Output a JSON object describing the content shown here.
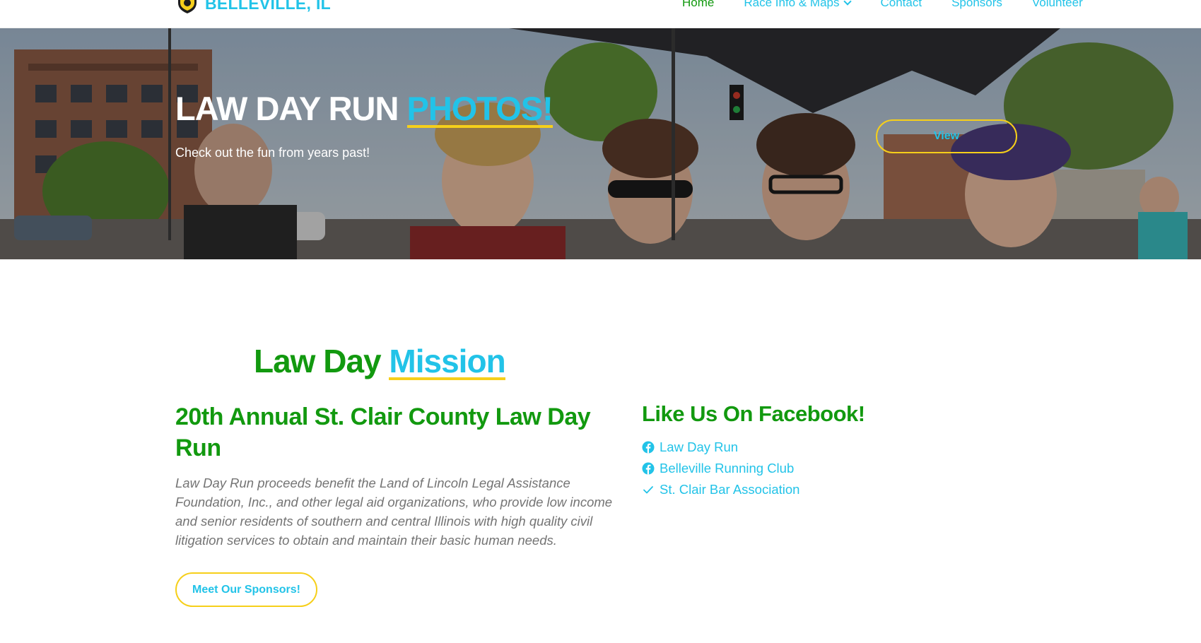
{
  "header": {
    "logo_text": "BELLEVILLE, IL",
    "nav": [
      {
        "label": "Home",
        "active": true
      },
      {
        "label": "Race Info & Maps",
        "dropdown": true
      },
      {
        "label": "Contact"
      },
      {
        "label": "Sponsors"
      },
      {
        "label": "Volunteer"
      }
    ]
  },
  "hero": {
    "title_main": "LAW DAY RUN ",
    "title_accent": "PHOTOS!",
    "subtitle": "Check out the fun from years past!",
    "button_label": "View"
  },
  "mission": {
    "heading_main": "Law Day ",
    "heading_accent": "Mission",
    "run_title": "20th Annual St. Clair County Law Day Run",
    "description": "Law Day Run proceeds benefit the Land of Lincoln Legal Assistance Foundation, Inc., and other legal aid organizations, who provide low income and senior residents of southern and central Illinois with high quality civil litigation services to obtain and maintain their basic human needs.",
    "sponsor_button": "Meet Our Sponsors!"
  },
  "facebook": {
    "heading": "Like Us On Facebook!",
    "links": [
      {
        "label": "Law Day Run",
        "icon": "facebook-icon"
      },
      {
        "label": "Belleville Running Club",
        "icon": "facebook-icon"
      },
      {
        "label": "St. Clair Bar Association",
        "icon": "check-icon"
      }
    ]
  },
  "colors": {
    "green": "#12990f",
    "cyan": "#22c3e8",
    "yellow": "#f6cf1a",
    "gray_text": "#747474"
  }
}
